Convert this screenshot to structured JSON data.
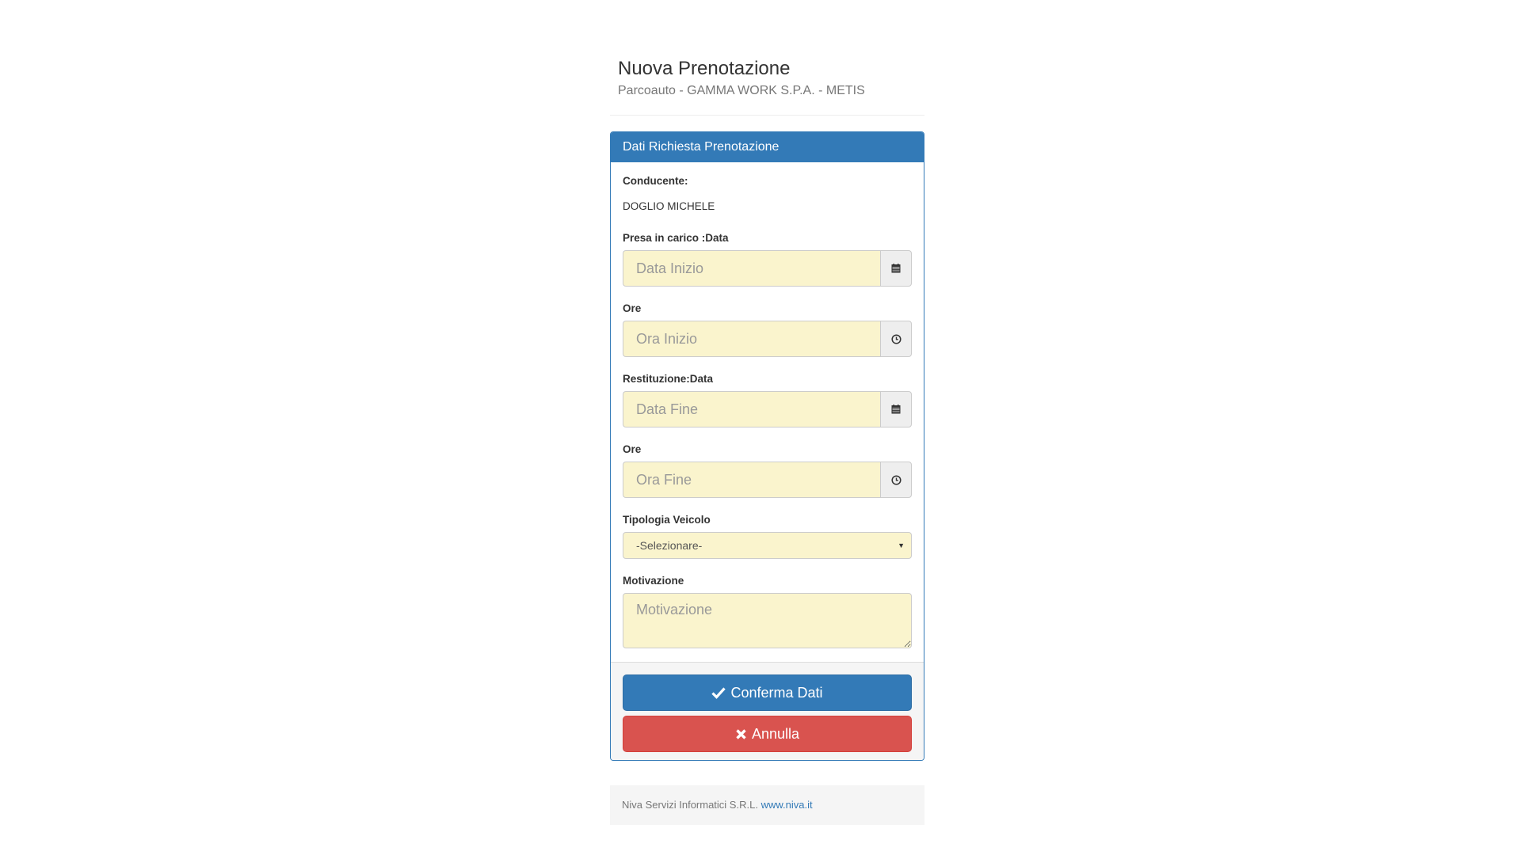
{
  "header": {
    "title": "Nuova Prenotazione",
    "subtitle": "Parcoauto - GAMMA WORK S.P.A. - METIS"
  },
  "panel": {
    "heading": "Dati Richiesta Prenotazione",
    "driver_label": "Conducente:",
    "driver_value": "DOGLIO MICHELE",
    "pickup_date_label": "Presa in carico :Data",
    "pickup_date_placeholder": "Data Inizio",
    "pickup_time_label": "Ore",
    "pickup_time_placeholder": "Ora Inizio",
    "return_date_label": "Restituzione:Data",
    "return_date_placeholder": "Data Fine",
    "return_time_label": "Ore",
    "return_time_placeholder": "Ora Fine",
    "vehicle_type_label": "Tipologia Veicolo",
    "vehicle_type_selected": "-Selezionare-",
    "reason_label": "Motivazione",
    "reason_placeholder": "Motivazione"
  },
  "actions": {
    "confirm_label": "Conferma Dati",
    "cancel_label": "Annulla"
  },
  "footer": {
    "company": "Niva Servizi Informatici S.R.L.",
    "link_text": "www.niva.it"
  },
  "icons": {
    "date": "calendar-icon",
    "time": "clock-icon",
    "confirm": "check-icon",
    "cancel": "x-icon",
    "select": "caret-down-icon"
  },
  "colors": {
    "primary": "#337ab7",
    "danger": "#d9534f",
    "input_bg": "#faf4cd"
  }
}
